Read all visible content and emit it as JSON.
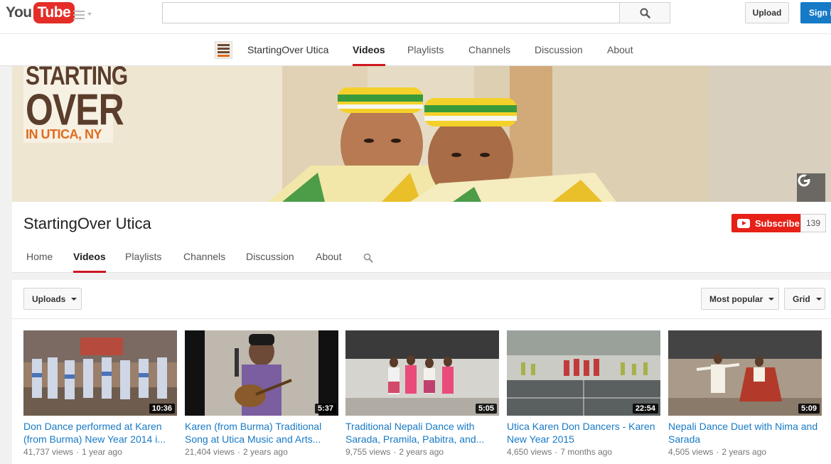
{
  "masthead": {
    "logo_you": "You",
    "logo_tube": "Tube",
    "search": {
      "placeholder": ""
    },
    "upload_label": "Upload",
    "signin_label": "Sign in"
  },
  "top_nav": {
    "channel_name": "StartingOver Utica",
    "items": [
      "Videos",
      "Playlists",
      "Channels",
      "Discussion",
      "About"
    ],
    "active": "Videos"
  },
  "banner": {
    "logo_line1": "STARTING",
    "logo_line2": "OVER",
    "logo_line3": "IN UTICA, NY",
    "google_icon": "google-plus-icon"
  },
  "channel": {
    "title": "StartingOver Utica",
    "subscribe_label": "Subscribe",
    "subscriber_count": "139",
    "tabs": [
      "Home",
      "Videos",
      "Playlists",
      "Channels",
      "Discussion",
      "About"
    ],
    "active_tab": "Videos"
  },
  "filters": {
    "uploads_label": "Uploads",
    "sort_label": "Most popular",
    "view_label": "Grid"
  },
  "videos": [
    {
      "title": "Don Dance performed at Karen (from Burma) New Year 2014 i...",
      "duration": "10:36",
      "views": "41,737 views",
      "age": "1 year ago"
    },
    {
      "title": "Karen (from Burma) Traditional Song at Utica Music and Arts...",
      "duration": "5:37",
      "views": "21,404 views",
      "age": "2 years ago"
    },
    {
      "title": "Traditional Nepali Dance with Sarada, Pramila, Pabitra, and...",
      "duration": "5:05",
      "views": "9,755 views",
      "age": "2 years ago"
    },
    {
      "title": "Utica Karen Don Dancers - Karen New Year 2015",
      "duration": "22:54",
      "views": "4,650 views",
      "age": "7 months ago"
    },
    {
      "title": "Nepali Dance Duet with Nima and Sarada",
      "duration": "5:09",
      "views": "4,505 views",
      "age": "2 years ago"
    }
  ],
  "colors": {
    "brand_red": "#e52d27",
    "subscribe_red": "#e62117",
    "link_blue": "#167ac6",
    "tab_underline": "#cc181e"
  }
}
